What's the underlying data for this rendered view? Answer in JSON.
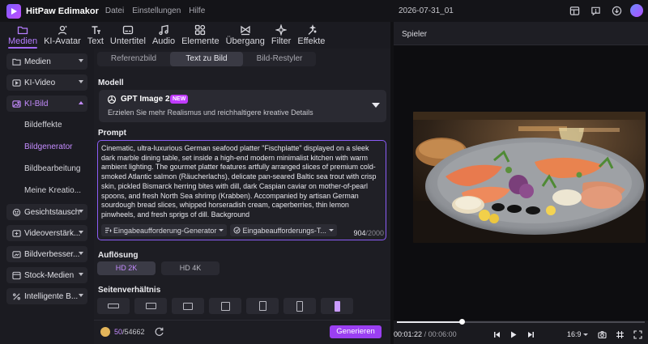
{
  "app": {
    "title": "HitPaw Edimakor",
    "menu": [
      "Datei",
      "Einstellungen",
      "Hilfe"
    ],
    "project_title": "2026-07-31_01",
    "accent": "#a46bff"
  },
  "toolbar": {
    "tabs": [
      {
        "label": "Medien",
        "icon": "media-folder-icon",
        "active": true
      },
      {
        "label": "KI-Avatar",
        "icon": "avatar-icon",
        "active": false
      },
      {
        "label": "Text",
        "icon": "text-icon",
        "active": false
      },
      {
        "label": "Untertitel",
        "icon": "subtitle-icon",
        "active": false
      },
      {
        "label": "Audio",
        "icon": "music-note-icon",
        "active": false
      },
      {
        "label": "Elemente",
        "icon": "elements-icon",
        "active": false
      },
      {
        "label": "Übergang",
        "icon": "transition-icon",
        "active": false
      },
      {
        "label": "Filter",
        "icon": "sparkle-icon",
        "active": false
      },
      {
        "label": "Effekte",
        "icon": "effects-icon",
        "active": false
      }
    ]
  },
  "sidebar": {
    "items": [
      {
        "label": "Medien",
        "icon": "folder-icon"
      },
      {
        "label": "KI-Video",
        "icon": "video-icon"
      },
      {
        "label": "KI-Bild",
        "icon": "image-icon",
        "open": true
      },
      {
        "label": "Gesichtstausch",
        "icon": "face-swap-icon"
      },
      {
        "label": "Videoverstärk...",
        "icon": "video-enhance-icon"
      },
      {
        "label": "Bildverbesser...",
        "icon": "image-enhance-icon"
      },
      {
        "label": "Stock-Medien",
        "icon": "stock-media-icon"
      },
      {
        "label": "Intelligente B...",
        "icon": "smart-icon"
      }
    ],
    "sub_items": [
      {
        "label": "Bildeffekte",
        "active": false
      },
      {
        "label": "Bildgenerator",
        "active": true
      },
      {
        "label": "Bildbearbeitung",
        "active": false
      },
      {
        "label": "Meine Kreatio...",
        "active": false
      }
    ]
  },
  "center": {
    "segments": [
      {
        "label": "Referenzbild",
        "active": false
      },
      {
        "label": "Text zu Bild",
        "active": true
      },
      {
        "label": "Bild-Restyler",
        "active": false
      }
    ],
    "model_label": "Modell",
    "model_name": "GPT Image 2",
    "model_badge": "NEW",
    "model_desc": "Erzielen Sie mehr Realismus und reichhaltigere kreative Details",
    "prompt_label": "Prompt",
    "prompt_text": "Cinematic, ultra-luxurious German seafood platter \"Fischplatte\" displayed on a sleek dark marble dining table, set inside a high-end modern minimalist kitchen with warm ambient lighting. The gourmet platter features artfully arranged slices of premium cold-smoked Atlantic salmon (Räucherlachs), delicate pan-seared Baltic sea trout with crisp skin, pickled Bismarck herring bites with dill, dark Caspian caviar on mother-of-pearl spoons, and fresh North Sea shrimp (Krabben). Accompanied by artisan German sourdough bread slices, whipped horseradish cream, caperberries, thin lemon pinwheels, and fresh sprigs of dill. Background",
    "prompt_tool_1": "Eingabeaufforderung-Generator",
    "prompt_tool_2": "Eingabeaufforderungs-T...",
    "char_count": "904",
    "char_max": "/2000",
    "resolution_label": "Auflösung",
    "resolutions": [
      {
        "label": "HD 2K",
        "active": true
      },
      {
        "label": "HD 4K",
        "active": false
      }
    ],
    "aspect_label": "Seitenverhältnis",
    "credits_used": "50",
    "credits_total": "/54662",
    "generate_label": "Generieren"
  },
  "player": {
    "title": "Spieler",
    "current_time": "00:01:22",
    "duration": "/ 00:06:00",
    "progress": 0.26,
    "aspect": "16:9"
  }
}
